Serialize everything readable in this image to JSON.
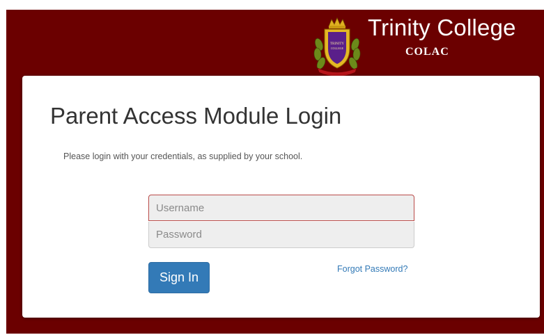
{
  "header": {
    "college_name": "Trinity College",
    "college_sub": "COLAC",
    "logo_icon": "school-crest-icon"
  },
  "login": {
    "title": "Parent Access Module Login",
    "intro": "Please login with your credentials, as supplied by your school.",
    "username_placeholder": "Username",
    "password_placeholder": "Password",
    "sign_in_label": "Sign In",
    "forgot_label": "Forgot Password?"
  },
  "colors": {
    "background": "#6b0000",
    "primary_button": "#337ab7",
    "error_border": "#b94a48"
  }
}
